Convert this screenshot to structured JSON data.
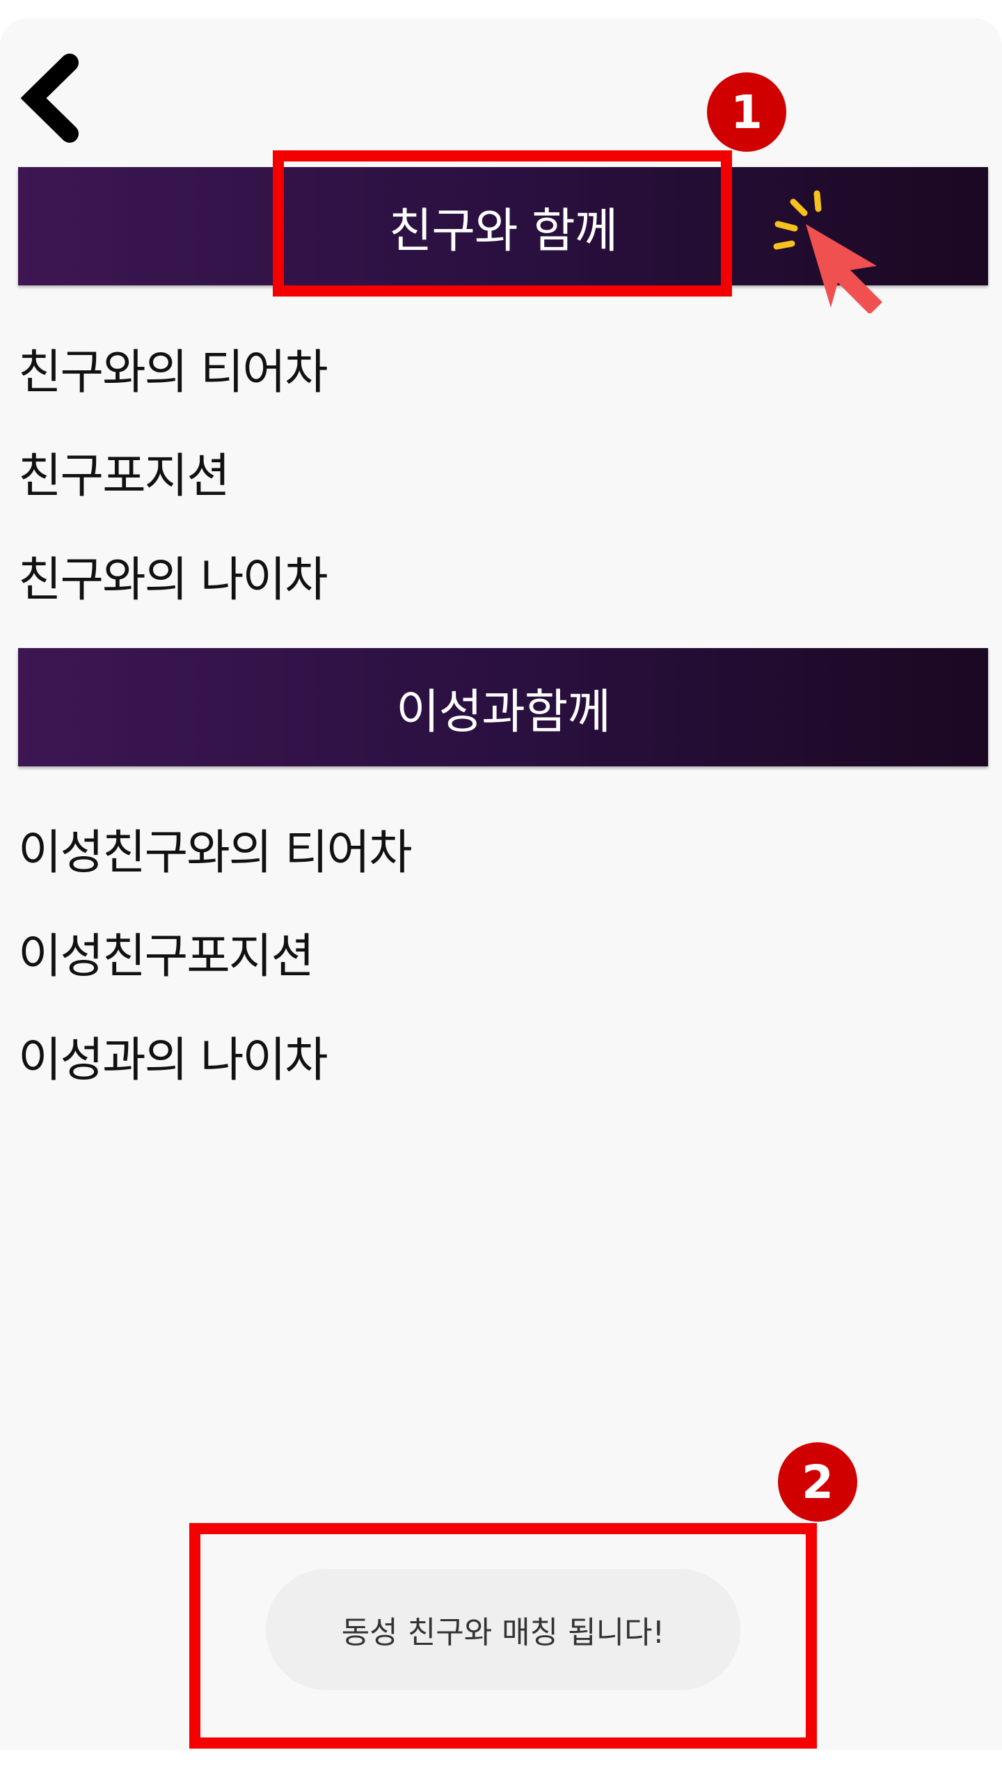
{
  "header": {
    "back_icon": "chevron-left-icon"
  },
  "sections": {
    "friends": {
      "title": "친구와 함께",
      "items": [
        "친구와의 티어차",
        "친구포지션",
        "친구와의 나이차"
      ]
    },
    "opposite": {
      "title": "이성과함께",
      "items": [
        "이성친구와의 티어차",
        "이성친구포지션",
        "이성과의 나이차"
      ]
    }
  },
  "toast": {
    "message": "동성 친구와 매칭 됩니다!"
  },
  "annotations": {
    "step1_label": "1",
    "step2_label": "2",
    "highlight_color": "#f40000",
    "badge_color": "#d10000",
    "pointer_icon": "click-pointer-icon"
  },
  "colors": {
    "bar_gradient_start": "#3d1652",
    "bar_gradient_end": "#1b0822",
    "background": "#f8f8f8"
  }
}
